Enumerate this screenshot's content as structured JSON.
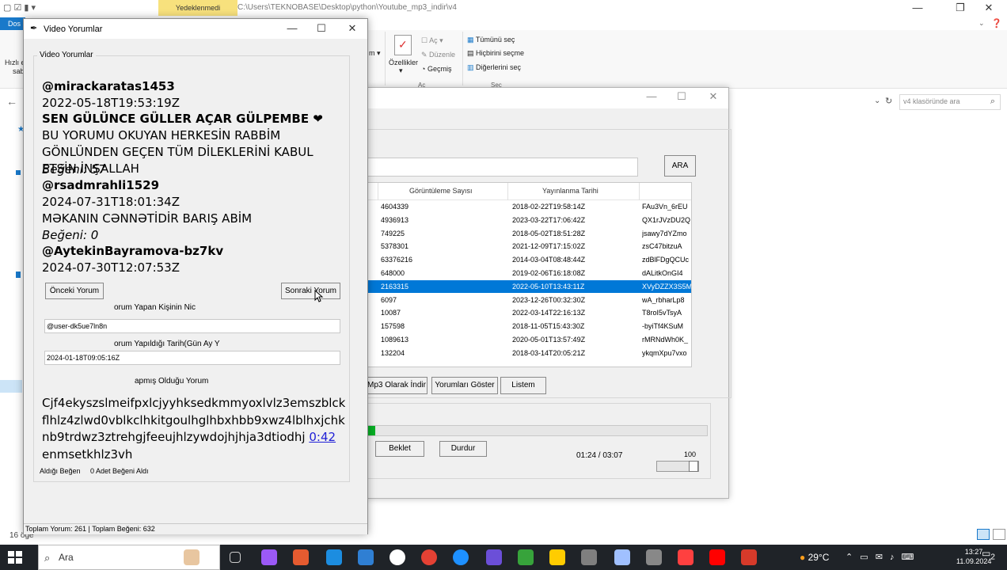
{
  "explorer": {
    "context_tab": "Yedeklenmedi",
    "path": "C:\\Users\\TEKNOBASE\\Desktop\\python\\Youtube_mp3_indir\\v4",
    "file_tab": "Dos",
    "ribbon": {
      "partial_left": [
        "Hızlı e",
        "sab"
      ],
      "properties_label": "Özellikler",
      "open_label": "Aç",
      "edit_label": "Düzenle",
      "history_label": "Geçmiş",
      "open_group": "Aç",
      "select_all": "Tümünü seç",
      "select_none": "Hiçbirini seçme",
      "invert_selection": "Diğerlerini seç",
      "select_group": "Seç"
    },
    "search_placeholder": "v4 klasöründe ara",
    "item_count": "16 öğe"
  },
  "taskbar": {
    "search_placeholder": "Ara",
    "weather": "29°C",
    "time": "13:27",
    "date": "11.09.2024",
    "notifications": "2",
    "icon_colors": [
      "#e8c6a0",
      "#555b63",
      "#9b59f6",
      "#e55b30",
      "#1c8de0",
      "#2f7fd3",
      "#ffffff",
      "#e44134",
      "#1e90ff",
      "#6b4fd8",
      "#37a33b",
      "#ffcc00",
      "#7f7f7f",
      "#a0c0ff",
      "#888888",
      "#ff4040",
      "#ff0000",
      "#d63a2a",
      "#444444",
      "#34a853",
      "#d33"
    ]
  },
  "app": {
    "search_button": "ARA",
    "columns": [
      "Görüntüleme Sayısı",
      "Yayınlanma Tarihi"
    ],
    "rows": [
      {
        "views": "4604339",
        "date": "2018-02-22T19:58:14Z",
        "id": "FAu3Vn_6rEU",
        "selected": false
      },
      {
        "views": "4936913",
        "date": "2023-03-22T17:06:42Z",
        "id": "QX1rJVzDU2Q",
        "selected": false
      },
      {
        "views": "749225",
        "date": "2018-05-02T18:51:28Z",
        "id": "jsawy7dYZmo",
        "selected": false
      },
      {
        "views": "5378301",
        "date": "2021-12-09T17:15:02Z",
        "id": "zsC47bitzuA",
        "selected": false
      },
      {
        "views": "63376216",
        "date": "2014-03-04T08:48:44Z",
        "id": "zdBlFDgQCUc",
        "selected": false
      },
      {
        "views": "648000",
        "date": "2019-02-06T16:18:08Z",
        "id": "dALitkOnGI4",
        "selected": false
      },
      {
        "views": "2163315",
        "date": "2022-05-10T13:43:11Z",
        "id": "XVyDZZX3S5M",
        "selected": true
      },
      {
        "views": "6097",
        "date": "2023-12-26T00:32:30Z",
        "id": "wA_rbharLp8",
        "selected": false
      },
      {
        "views": "10087",
        "date": "2022-03-14T22:16:13Z",
        "id": "T8roI5vTsyA",
        "selected": false
      },
      {
        "views": "157598",
        "date": "2018-11-05T15:43:30Z",
        "id": "-byiTf4KSuM",
        "selected": false
      },
      {
        "views": "1089613",
        "date": "2020-05-01T13:57:49Z",
        "id": "rMRNdWh0K_",
        "selected": false
      },
      {
        "views": "132204",
        "date": "2018-03-14T20:05:21Z",
        "id": "ykqmXpu7vxo",
        "selected": false
      }
    ],
    "buttons": {
      "mp3": "Mp3 Olarak İndir",
      "comments": "Yorumları Göster",
      "list": "Listem",
      "pause": "Beklet",
      "stop": "Durdur"
    },
    "progress": 0.02,
    "time": "01:24 / 03:07",
    "volume_label": "100",
    "volume": 1.0
  },
  "comments_window": {
    "title": "Video Yorumlar",
    "group_label": "Video Yorumlar",
    "comments": [
      {
        "author": "@mirackaratas1453",
        "date": "2022-05-18T19:53:19Z",
        "text_bold": "SEN GÜLÜNCE GÜLLER AÇAR GÜLPEMBE ❤",
        "text": " BU YORUMU OKUYAN HERKESİN RABBİM GÖNLÜNDEN GEÇEN TÜM DİLEKLERİNİ KABUL ETSİN İNŞALLAH",
        "likes": "Beğeni: 57"
      },
      {
        "author": "@rsadmrahli1529",
        "date": "2024-07-31T18:01:34Z",
        "text": "MƏKANIN CƏNNƏTİDİR BARIŞ ABİM",
        "likes": "Beğeni: 0"
      },
      {
        "author": "@AytekinBayramova-bz7kv",
        "date": "2024-07-30T12:07:53Z"
      }
    ],
    "prev_button": "Önceki Yorum",
    "next_button": "Sonraki Yorum",
    "nick_label": "orum Yapan Kişinin Nic",
    "nick_value": "@user-dk5ue7ln8n",
    "date_label": "orum Yapıldığı Tarih(Gün Ay Y",
    "date_value": "2024-01-18T09:05:16Z",
    "comment_label": "apmış Olduğu Yorum",
    "comment_text": "Cjf4ekyszslmeifpxlcjyyhksedkmmyoxlvlz3emszblckflhlz4zlwd0vblkclhkitgoulhglhbxhbb9xwz4lblhxjchknb9trdwz3ztrehgjfeeujhlzywdojhjhja3dtiodhj",
    "comment_link": "0:42",
    "comment_tail": "enmsetkhlz3vh",
    "likes_label": "Aldığı Beğen",
    "likes_value": "0 Adet Beğeni Aldı",
    "status": "Toplam Yorum: 261 | Toplam Beğeni: 632"
  }
}
